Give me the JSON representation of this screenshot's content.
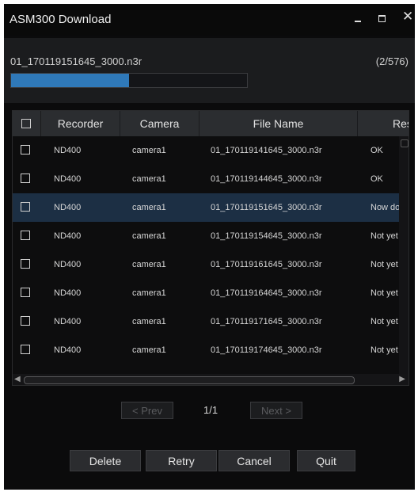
{
  "window": {
    "title": "ASM300 Download"
  },
  "titlebar_icons": {
    "minimize": "minimize-icon",
    "maximize": "maximize-icon",
    "close": "close-icon",
    "close_glyph": "✕"
  },
  "progress": {
    "current_file": "01_170119151645_3000.n3r",
    "counter": "(2/576)",
    "fraction": 0.5,
    "fill_color": "#2f79b9"
  },
  "table": {
    "columns": [
      "Recorder",
      "Camera",
      "File Name",
      "Res"
    ],
    "rows": [
      {
        "recorder": "ND400",
        "camera": "camera1",
        "file": "01_170119141645_3000.n3r",
        "result": "OK",
        "selected": false
      },
      {
        "recorder": "ND400",
        "camera": "camera1",
        "file": "01_170119144645_3000.n3r",
        "result": "OK",
        "selected": false
      },
      {
        "recorder": "ND400",
        "camera": "camera1",
        "file": "01_170119151645_3000.n3r",
        "result": "Now dov",
        "selected": true
      },
      {
        "recorder": "ND400",
        "camera": "camera1",
        "file": "01_170119154645_3000.n3r",
        "result": "Not yet",
        "selected": false
      },
      {
        "recorder": "ND400",
        "camera": "camera1",
        "file": "01_170119161645_3000.n3r",
        "result": "Not yet",
        "selected": false
      },
      {
        "recorder": "ND400",
        "camera": "camera1",
        "file": "01_170119164645_3000.n3r",
        "result": "Not yet",
        "selected": false
      },
      {
        "recorder": "ND400",
        "camera": "camera1",
        "file": "01_170119171645_3000.n3r",
        "result": "Not yet",
        "selected": false
      },
      {
        "recorder": "ND400",
        "camera": "camera1",
        "file": "01_170119174645_3000.n3r",
        "result": "Not yet",
        "selected": false
      }
    ]
  },
  "pager": {
    "prev_label": "< Prev",
    "page": "1/1",
    "next_label": "Next >"
  },
  "actions": {
    "delete": "Delete",
    "retry": "Retry",
    "cancel": "Cancel",
    "quit": "Quit"
  },
  "colors": {
    "selected_row": "#1c2f44",
    "background": "#0b0b0c"
  }
}
